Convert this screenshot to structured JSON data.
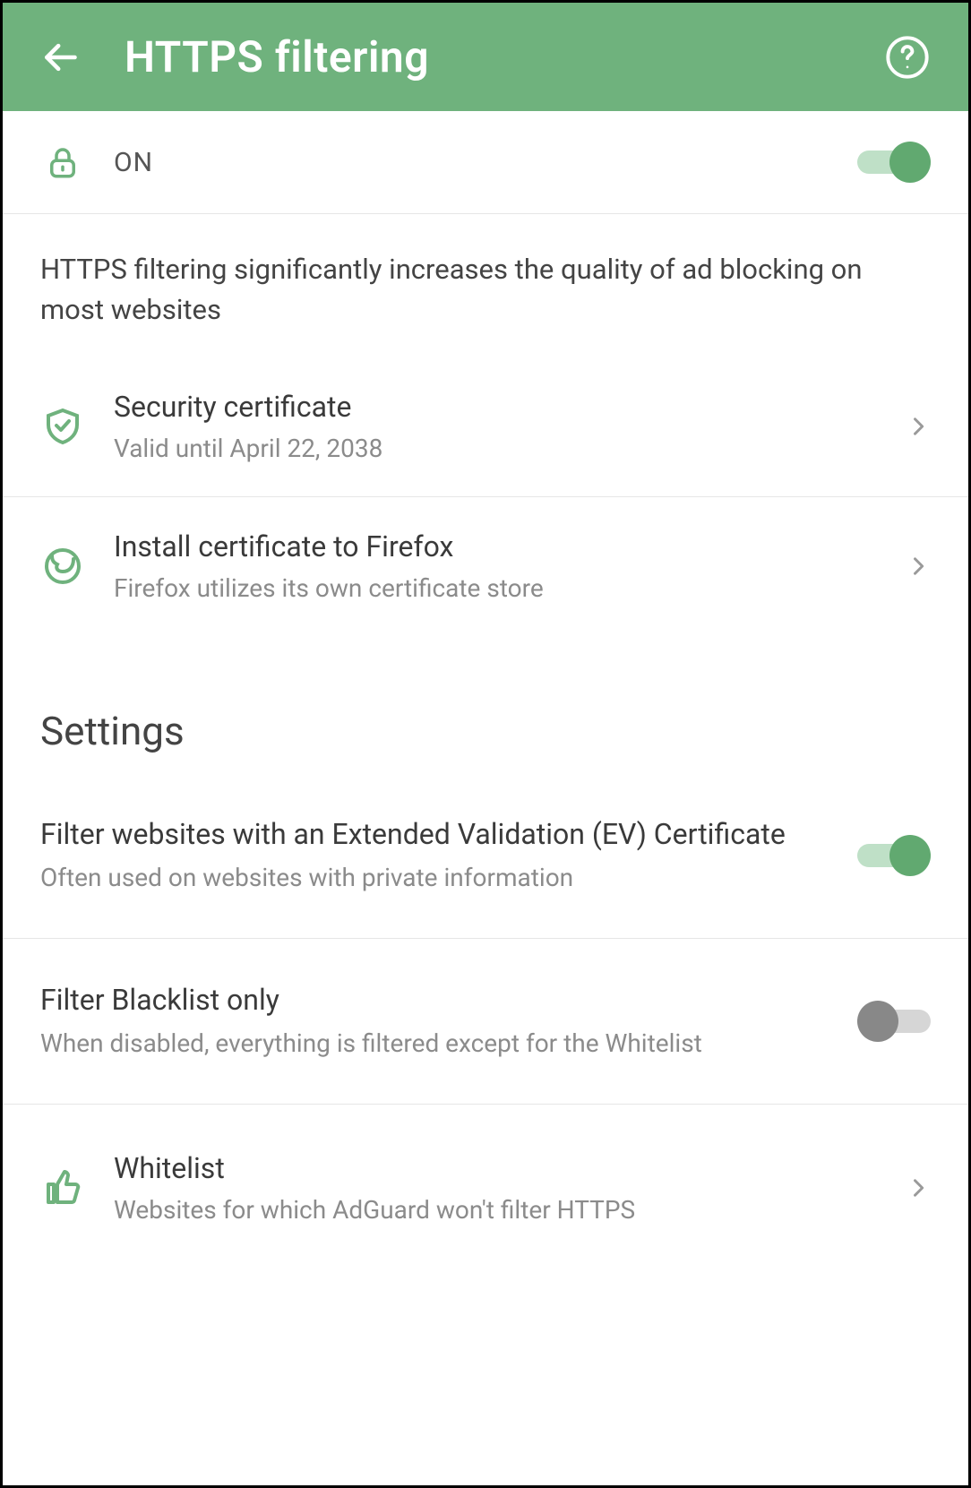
{
  "header": {
    "title": "HTTPS filtering"
  },
  "mainToggle": {
    "label": "ON",
    "on": true
  },
  "info": "HTTPS filtering significantly increases the quality of ad blocking on most websites",
  "items": {
    "cert": {
      "title": "Security certificate",
      "subtitle": "Valid until April 22, 2038"
    },
    "firefox": {
      "title": "Install certificate to Firefox",
      "subtitle": "Firefox utilizes its own certificate store"
    },
    "whitelist": {
      "title": "Whitelist",
      "subtitle": "Websites for which AdGuard won't filter HTTPS"
    }
  },
  "settingsHeader": "Settings",
  "settings": {
    "ev": {
      "title": "Filter websites with an Extended Validation (EV) Certificate",
      "subtitle": "Often used on websites with private information",
      "on": true
    },
    "blacklist": {
      "title": "Filter Blacklist only",
      "subtitle": "When disabled, everything is filtered except for the Whitelist",
      "on": false
    }
  }
}
